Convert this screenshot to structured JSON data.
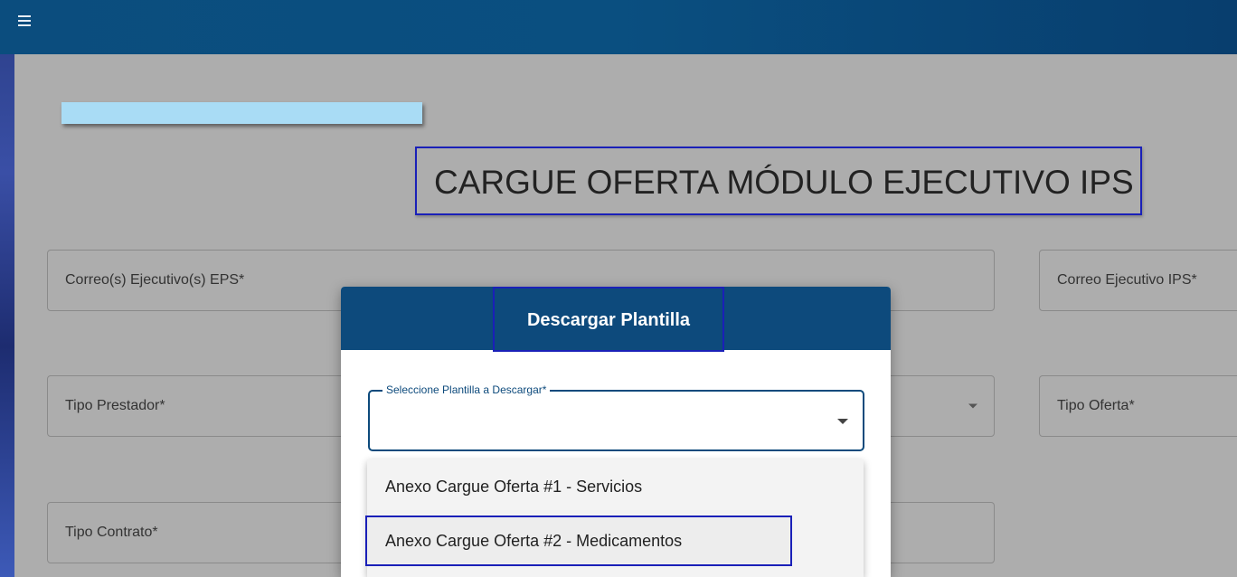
{
  "header": {
    "menu_icon": "hamburger-icon"
  },
  "page": {
    "title": "CARGUE OFERTA MÓDULO EJECUTIVO IPS",
    "fields": {
      "correo_eps": "Correo(s) Ejecutivo(s) EPS*",
      "correo_ips": "Correo Ejecutivo IPS*",
      "tipo_prestador": "Tipo Prestador*",
      "tipo_oferta": "Tipo Oferta*",
      "tipo_contrato": "Tipo Contrato*"
    }
  },
  "dialog": {
    "title": "Descargar Plantilla",
    "select_label": "Seleccione Plantilla a Descargar*",
    "options": [
      "Anexo Cargue Oferta #1 - Servicios",
      "Anexo Cargue Oferta #2 - Medicamentos"
    ]
  },
  "colors": {
    "header_blue": "#0d4a7c",
    "highlight_border": "#1a20b8",
    "accent_bar": "#a9dcf5"
  }
}
